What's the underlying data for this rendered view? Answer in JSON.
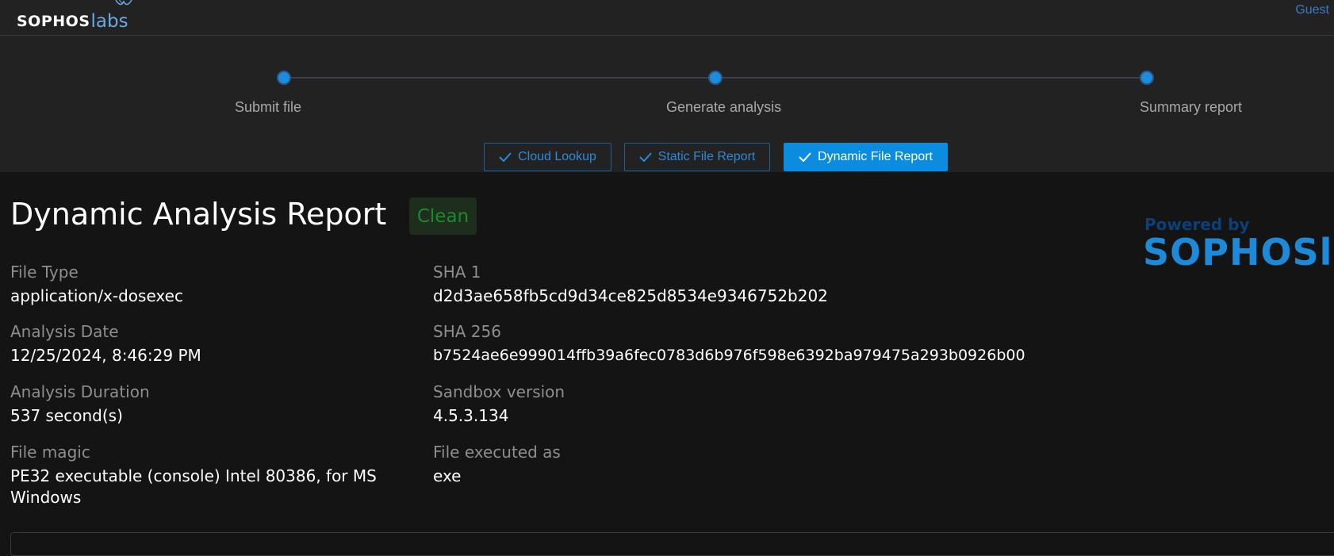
{
  "header": {
    "logo_text": "SOPHOS",
    "logo_accent": "labs",
    "user": "Guest"
  },
  "steps": [
    {
      "label": "Submit file"
    },
    {
      "label": "Generate analysis"
    },
    {
      "label": "Summary report"
    }
  ],
  "tabs": [
    {
      "label": "Cloud Lookup",
      "active": false
    },
    {
      "label": "Static File Report",
      "active": false
    },
    {
      "label": "Dynamic File Report",
      "active": true
    }
  ],
  "report": {
    "title": "Dynamic Analysis Report",
    "verdict": "Clean",
    "powered_by": "Powered by",
    "powered_brand": "SOPHOSlabs"
  },
  "fields": {
    "file_type": {
      "label": "File Type",
      "value": "application/x-dosexec"
    },
    "analysis_date": {
      "label": "Analysis Date",
      "value": "12/25/2024, 8:46:29 PM"
    },
    "analysis_duration": {
      "label": "Analysis Duration",
      "value": "537 second(s)"
    },
    "file_magic": {
      "label": "File magic",
      "value": "PE32 executable (console) Intel 80386, for MS Windows"
    },
    "sha1": {
      "label": "SHA 1",
      "value": "d2d3ae658fb5cd9d34ce825d8534e9346752b202"
    },
    "sha256": {
      "label": "SHA 256",
      "value": "b7524ae6e999014ffb39a6fec0783d6b976f598e6392ba979475a293b0926b00"
    },
    "sandbox_version": {
      "label": "Sandbox version",
      "value": "4.5.3.134"
    },
    "executed_as": {
      "label": "File executed as",
      "value": "exe"
    }
  },
  "colors": {
    "accent": "#0b8cde",
    "verdict_clean": "#1c8a2c",
    "background": "#141414",
    "panel": "#222222"
  }
}
